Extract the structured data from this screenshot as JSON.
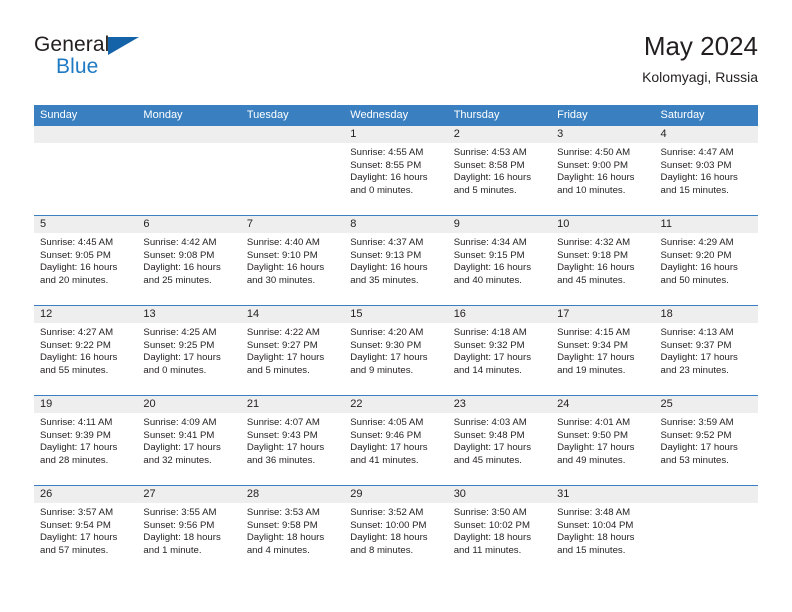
{
  "brand": {
    "line1": "General",
    "line2": "Blue",
    "triangle_color": "#1463a8"
  },
  "header": {
    "title": "May 2024",
    "subtitle": "Kolomyagi, Russia"
  },
  "theme": {
    "header_blue": "#3a80c1",
    "day_band_gray": "#eeeeee",
    "text": "#231f20"
  },
  "weekdays": [
    "Sunday",
    "Monday",
    "Tuesday",
    "Wednesday",
    "Thursday",
    "Friday",
    "Saturday"
  ],
  "weeks": [
    [
      {
        "day": "",
        "blank": true
      },
      {
        "day": "",
        "blank": true
      },
      {
        "day": "",
        "blank": true
      },
      {
        "day": "1",
        "sunrise": "Sunrise: 4:55 AM",
        "sunset": "Sunset: 8:55 PM",
        "daylight": "Daylight: 16 hours and 0 minutes."
      },
      {
        "day": "2",
        "sunrise": "Sunrise: 4:53 AM",
        "sunset": "Sunset: 8:58 PM",
        "daylight": "Daylight: 16 hours and 5 minutes."
      },
      {
        "day": "3",
        "sunrise": "Sunrise: 4:50 AM",
        "sunset": "Sunset: 9:00 PM",
        "daylight": "Daylight: 16 hours and 10 minutes."
      },
      {
        "day": "4",
        "sunrise": "Sunrise: 4:47 AM",
        "sunset": "Sunset: 9:03 PM",
        "daylight": "Daylight: 16 hours and 15 minutes."
      }
    ],
    [
      {
        "day": "5",
        "sunrise": "Sunrise: 4:45 AM",
        "sunset": "Sunset: 9:05 PM",
        "daylight": "Daylight: 16 hours and 20 minutes."
      },
      {
        "day": "6",
        "sunrise": "Sunrise: 4:42 AM",
        "sunset": "Sunset: 9:08 PM",
        "daylight": "Daylight: 16 hours and 25 minutes."
      },
      {
        "day": "7",
        "sunrise": "Sunrise: 4:40 AM",
        "sunset": "Sunset: 9:10 PM",
        "daylight": "Daylight: 16 hours and 30 minutes."
      },
      {
        "day": "8",
        "sunrise": "Sunrise: 4:37 AM",
        "sunset": "Sunset: 9:13 PM",
        "daylight": "Daylight: 16 hours and 35 minutes."
      },
      {
        "day": "9",
        "sunrise": "Sunrise: 4:34 AM",
        "sunset": "Sunset: 9:15 PM",
        "daylight": "Daylight: 16 hours and 40 minutes."
      },
      {
        "day": "10",
        "sunrise": "Sunrise: 4:32 AM",
        "sunset": "Sunset: 9:18 PM",
        "daylight": "Daylight: 16 hours and 45 minutes."
      },
      {
        "day": "11",
        "sunrise": "Sunrise: 4:29 AM",
        "sunset": "Sunset: 9:20 PM",
        "daylight": "Daylight: 16 hours and 50 minutes."
      }
    ],
    [
      {
        "day": "12",
        "sunrise": "Sunrise: 4:27 AM",
        "sunset": "Sunset: 9:22 PM",
        "daylight": "Daylight: 16 hours and 55 minutes."
      },
      {
        "day": "13",
        "sunrise": "Sunrise: 4:25 AM",
        "sunset": "Sunset: 9:25 PM",
        "daylight": "Daylight: 17 hours and 0 minutes."
      },
      {
        "day": "14",
        "sunrise": "Sunrise: 4:22 AM",
        "sunset": "Sunset: 9:27 PM",
        "daylight": "Daylight: 17 hours and 5 minutes."
      },
      {
        "day": "15",
        "sunrise": "Sunrise: 4:20 AM",
        "sunset": "Sunset: 9:30 PM",
        "daylight": "Daylight: 17 hours and 9 minutes."
      },
      {
        "day": "16",
        "sunrise": "Sunrise: 4:18 AM",
        "sunset": "Sunset: 9:32 PM",
        "daylight": "Daylight: 17 hours and 14 minutes."
      },
      {
        "day": "17",
        "sunrise": "Sunrise: 4:15 AM",
        "sunset": "Sunset: 9:34 PM",
        "daylight": "Daylight: 17 hours and 19 minutes."
      },
      {
        "day": "18",
        "sunrise": "Sunrise: 4:13 AM",
        "sunset": "Sunset: 9:37 PM",
        "daylight": "Daylight: 17 hours and 23 minutes."
      }
    ],
    [
      {
        "day": "19",
        "sunrise": "Sunrise: 4:11 AM",
        "sunset": "Sunset: 9:39 PM",
        "daylight": "Daylight: 17 hours and 28 minutes."
      },
      {
        "day": "20",
        "sunrise": "Sunrise: 4:09 AM",
        "sunset": "Sunset: 9:41 PM",
        "daylight": "Daylight: 17 hours and 32 minutes."
      },
      {
        "day": "21",
        "sunrise": "Sunrise: 4:07 AM",
        "sunset": "Sunset: 9:43 PM",
        "daylight": "Daylight: 17 hours and 36 minutes."
      },
      {
        "day": "22",
        "sunrise": "Sunrise: 4:05 AM",
        "sunset": "Sunset: 9:46 PM",
        "daylight": "Daylight: 17 hours and 41 minutes."
      },
      {
        "day": "23",
        "sunrise": "Sunrise: 4:03 AM",
        "sunset": "Sunset: 9:48 PM",
        "daylight": "Daylight: 17 hours and 45 minutes."
      },
      {
        "day": "24",
        "sunrise": "Sunrise: 4:01 AM",
        "sunset": "Sunset: 9:50 PM",
        "daylight": "Daylight: 17 hours and 49 minutes."
      },
      {
        "day": "25",
        "sunrise": "Sunrise: 3:59 AM",
        "sunset": "Sunset: 9:52 PM",
        "daylight": "Daylight: 17 hours and 53 minutes."
      }
    ],
    [
      {
        "day": "26",
        "sunrise": "Sunrise: 3:57 AM",
        "sunset": "Sunset: 9:54 PM",
        "daylight": "Daylight: 17 hours and 57 minutes."
      },
      {
        "day": "27",
        "sunrise": "Sunrise: 3:55 AM",
        "sunset": "Sunset: 9:56 PM",
        "daylight": "Daylight: 18 hours and 1 minute."
      },
      {
        "day": "28",
        "sunrise": "Sunrise: 3:53 AM",
        "sunset": "Sunset: 9:58 PM",
        "daylight": "Daylight: 18 hours and 4 minutes."
      },
      {
        "day": "29",
        "sunrise": "Sunrise: 3:52 AM",
        "sunset": "Sunset: 10:00 PM",
        "daylight": "Daylight: 18 hours and 8 minutes."
      },
      {
        "day": "30",
        "sunrise": "Sunrise: 3:50 AM",
        "sunset": "Sunset: 10:02 PM",
        "daylight": "Daylight: 18 hours and 11 minutes."
      },
      {
        "day": "31",
        "sunrise": "Sunrise: 3:48 AM",
        "sunset": "Sunset: 10:04 PM",
        "daylight": "Daylight: 18 hours and 15 minutes."
      },
      {
        "day": "",
        "blank": true
      }
    ]
  ]
}
